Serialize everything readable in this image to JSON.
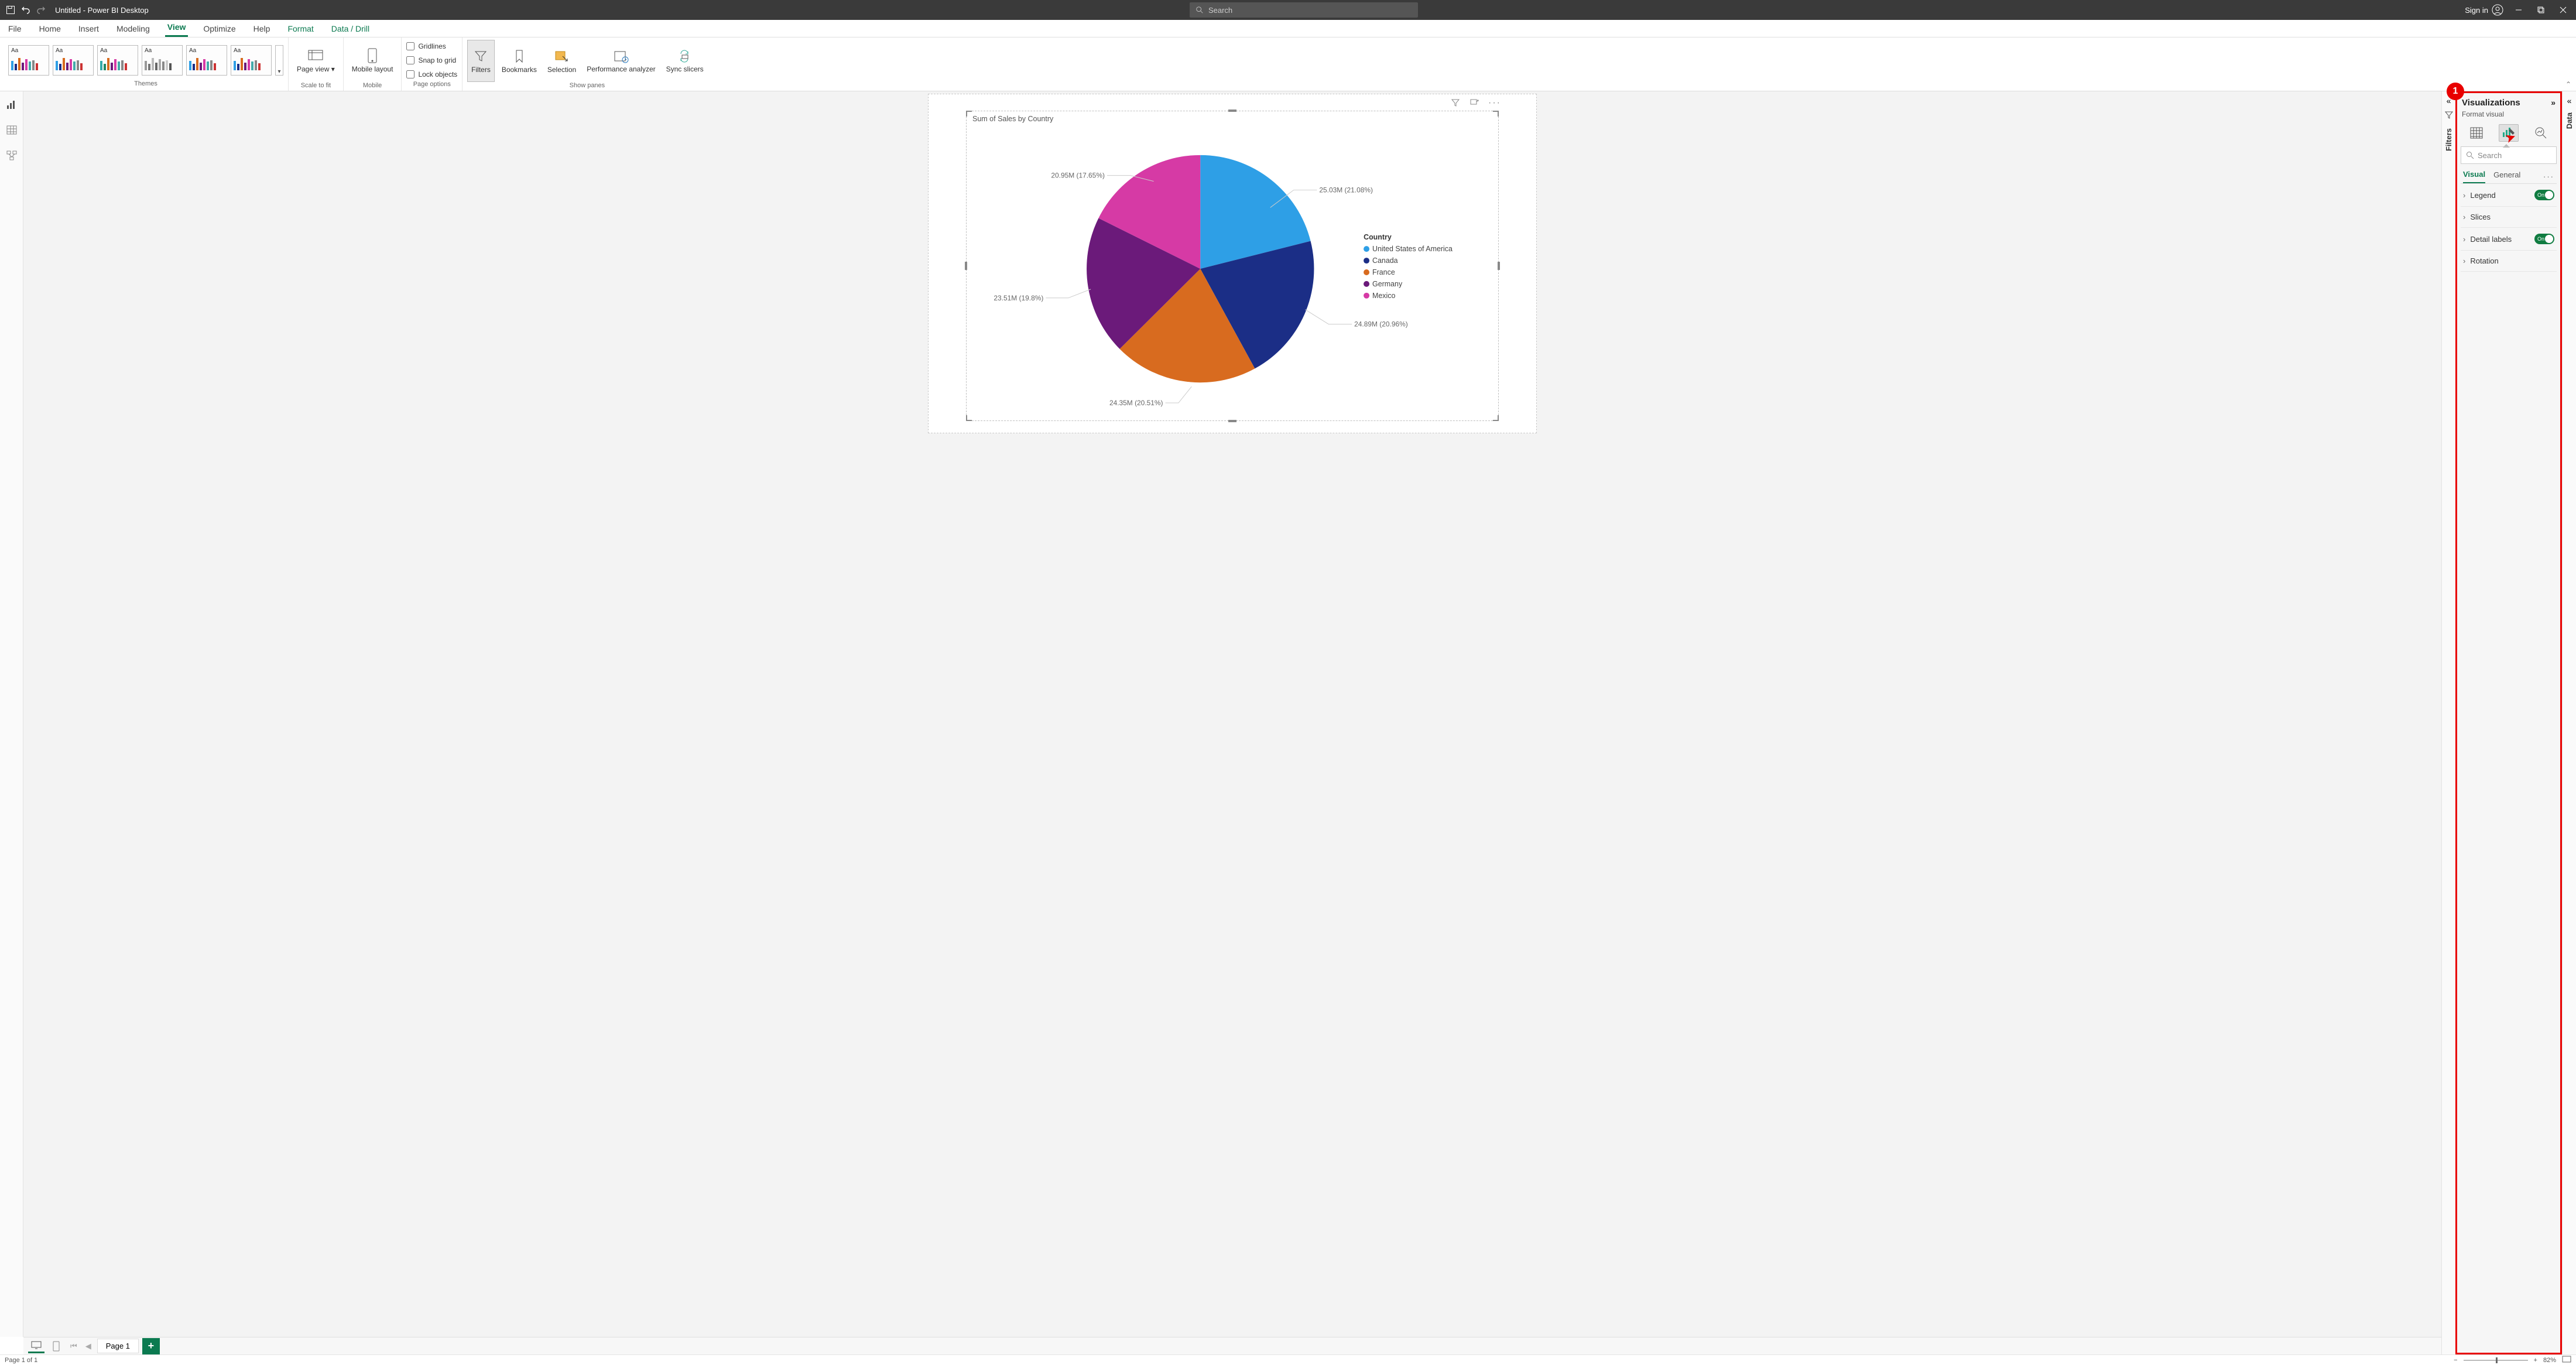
{
  "titlebar": {
    "title": "Untitled - Power BI Desktop",
    "search_placeholder": "Search",
    "signin": "Sign in"
  },
  "ribbon": {
    "tabs": [
      "File",
      "Home",
      "Insert",
      "Modeling",
      "View",
      "Optimize",
      "Help",
      "Format",
      "Data / Drill"
    ],
    "active_tab": "View",
    "groups": {
      "themes": "Themes",
      "scale": "Scale to fit",
      "mobile": "Mobile",
      "pageopts": "Page options",
      "panes": "Show panes"
    },
    "pageview": "Page view",
    "mobilelayout": "Mobile layout",
    "gridlines": "Gridlines",
    "snap": "Snap to grid",
    "lock": "Lock objects",
    "filters": "Filters",
    "bookmarks": "Bookmarks",
    "selection": "Selection",
    "perf": "Performance analyzer",
    "sync": "Sync slicers"
  },
  "canvas": {
    "visual_title": "Sum of Sales by Country",
    "legend_title": "Country"
  },
  "pages": {
    "tab1": "Page 1"
  },
  "statusbar": {
    "left": "Page 1 of 1",
    "zoom": "82%"
  },
  "rightpanes": {
    "filters": "Filters",
    "data": "Data",
    "viz_title": "Visualizations",
    "viz_sub": "Format visual",
    "search": "Search",
    "tab_visual": "Visual",
    "tab_general": "General",
    "legend": "Legend",
    "slices": "Slices",
    "detail": "Detail labels",
    "rotation": "Rotation",
    "on": "On"
  },
  "annotation": {
    "badge": "1"
  },
  "chart_data": {
    "type": "pie",
    "title": "Sum of Sales by Country",
    "legend_title": "Country",
    "slices": [
      {
        "category": "United States of America",
        "value": 25030000,
        "percent": 21.08,
        "label": "25.03M (21.08%)",
        "color": "#2e9fe6"
      },
      {
        "category": "Canada",
        "value": 24890000,
        "percent": 20.96,
        "label": "24.89M (20.96%)",
        "color": "#1b2e86"
      },
      {
        "category": "France",
        "value": 24350000,
        "percent": 20.51,
        "label": "24.35M (20.51%)",
        "color": "#d86b1f"
      },
      {
        "category": "Germany",
        "value": 23510000,
        "percent": 19.8,
        "label": "23.51M (19.8%)",
        "color": "#6b1a7a"
      },
      {
        "category": "Mexico",
        "value": 20950000,
        "percent": 17.65,
        "label": "20.95M (17.65%)",
        "color": "#d63aa5"
      }
    ]
  }
}
